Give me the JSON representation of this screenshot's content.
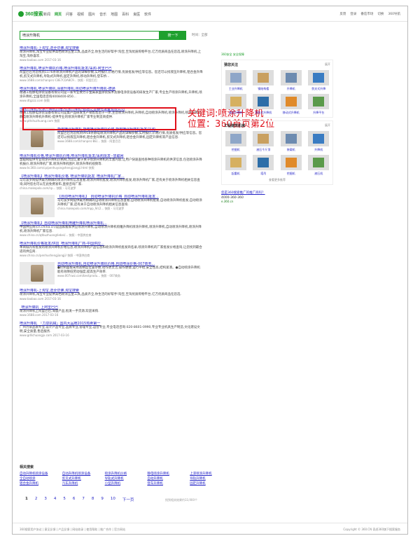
{
  "header": {
    "logo": "360搜索",
    "nav": [
      "新闻",
      "网页",
      "问答",
      "视频",
      "图片",
      "音乐",
      "地图",
      "百科",
      "良医",
      "软件"
    ],
    "nav_active_index": 1,
    "user_links": [
      "反馈",
      "登录",
      "番茄市场",
      "切换",
      "360导航"
    ]
  },
  "search": {
    "query": "喷涂升降机",
    "button": "搜一下",
    "time_filter": "时间：全部"
  },
  "annotation": {
    "line1": "关键词:喷涂升降机",
    "line2": "位置：360首页第2位"
  },
  "results": [
    {
      "title": "喷涂升降机-上淘宝,选全仿佛,淘宝搜索",
      "desc": "喷涂升降机,淘宝专业提供高档喷涂五金工具,品类齐全,你生活的好帮手!淘宝,至淘优质购物平台,亿万优质商品任您选,喷涂升降机,上淘宝,淘你喜欢.",
      "url": "www.taobao.com",
      "meta": "2017-03-16",
      "ad": true
    },
    {
      "title": "喷涂升降机,喷涂升降机价格,喷涂升降机批发/采购-阿里巴巴",
      "desc": "阿里巴巴为您找到1176条喷涂升降机产品的详细参数,实时报价,价格行情,优质批发/供应等信息。您还可以找液压升降机,铝合金升降机,剪叉式升降机,导轨式升降机,固定升降机,移动升降机,登车桥...",
      "url": "www.1688.com/chanpin/-C8E7CDABC9...",
      "meta": "快照 - 阿里巴巴"
    },
    {
      "title": "喷涂升降机,喷涂升降机,涂装升降机,自动喷涂升降升降机-德通",
      "desc": "德通工程静电涂装设备有限公司是一家专业致力于金属表面涂装技术及静电涂装设备的研发生产厂家,专业生产喷涂升降机,升降机,喷涂升降机,全国电话咨询4008400-850...",
      "url": "www.dtgzzz.com",
      "meta": "快照"
    },
    {
      "title": "喷涂升降机,喷涂升降机价格,喷涂升降机-德通泛普静电设备有限公司",
      "desc": "德通工程静电涂装设备有限公司是集产品研发生产销售售后于一体,主营喷涂升降机,升降机,自动喷涂升降机,喷涂升降机,喷涂升降机,静电喷涂升降机升降机-提供专业的喷涂升降机厂家专业制造商提供.",
      "url": "www.pttshuzhuang.com",
      "meta": "快照"
    },
    {
      "title": "静电喷涂升降机,静电喷涂升降机价格,静电喷涂升降机批发/采购...",
      "desc": "阿里巴巴为您找到9958条静电喷涂升降机产品的详细参数,实时报价,价格行情,优质批发/供应等信息。您还可以找液压升降机,铝合金升降机,剪叉式升降机,铝合金升降机,固定升降机等产品信息.",
      "url": "www.1688.com/chanpin/-BE/...",
      "meta": "快照 - 阿里巴巴",
      "img": true
    },
    {
      "title": "喷涂升降机价格,喷涂升降机价格,喷涂升降机批发/采购批发--慧聪网",
      "desc": "慧聪网提供专业喷涂升降机价格网,为您汇聚于关于喷涂升降机的丰富内容,让用户快速查找各种喷涂升降机的供求信息,包括喷涂升降机报价,喷涂升降机厂家,喷涂升降机图片,喷涂升降机视频等.",
      "url": "www.hc360.com/cp/penhuyongshengjiangji.html",
      "meta": "快照"
    },
    {
      "title": "【喷涂升降机】喷涂升降机价格_喷涂升降机批发_喷涂升降机厂家...",
      "desc": "马可波罗网提供最为精确的喷涂升降机信息查看,喷涂升降机批发,喷涂升降机批发,喷涂升降机厂家,还有关于喷涂升降机相关信息查询,同时您也可以在此免费发布,直接咨询厂家.",
      "url": "china.makepolo.com/cp...",
      "meta": "快照 - 马可波罗"
    },
    {
      "title": "【自动喷涂升降机】_自动喷涂升降机价格_自动喷涂升降机批发...",
      "desc": "马可波罗网提供最为精确的自动喷涂升降机信息查看,自动喷涂升降机批发,自动喷涂升降机批发,自动喷涂升降机厂家,还有关于自动喷涂升降机相关信息查询.",
      "url": "china.makepolo.com/mpp_9/c2...",
      "meta": "快照 - 马可波罗",
      "img": true
    },
    {
      "title": "【喷涂升降机】自动喷涂升降机喷雕升降机喷涂升降机...",
      "desc": "中国供应商(cn.china.cn)是国家搬家供应喷涂升降机,自动喷涂升降机喷雕升降机喷涂升降机,喷涂升降机,自动喷涂升降机,喷涂升降机,喷涂升降机厂家信息.",
      "url": "www.china.cn/qtbuzhuangtiebei/...",
      "meta": "快照 - 中国供应商"
    },
    {
      "title": "喷涂升降机价格批发/供应_喷涂升降机厂商-中国供应...",
      "desc": "本商城内有批发的喷涂升降机价格信息,喷涂升降机产品信息和喷涂升降机批发商名录,喷涂升降机的厂家批发价格查询,让您找到最合适的供应商.",
      "url": "www.china.cn/penhushengjiangji/",
      "meta": "快照 - 中国供应商"
    },
    {
      "title": "自动喷涂升降机,自动喷涂升降机价格,自动喷涂价格-007商务...",
      "desc": "●控制面板采用高精度位置参数,动作更灵活,操作便捷,运行平稳,安全性高,结构紧凑。●自动喷涂升降机能有效降低劳动强度,提高生产效率.",
      "url": "www.007swz.com/bestprodu...",
      "meta": "快照 - 007商务",
      "img": true
    },
    {
      "title": "喷涂升降机-上淘宝,选全仿佛,淘宝搜索",
      "desc": "喷涂升降机,淘宝专业提供高档喷涂五金工具,品类齐全,你生活的好帮手!淘宝,至淘优质购物平台,亿万优质商品任您选.",
      "url": "www.taobao.com",
      "meta": "2017-03-16",
      "ad": true
    },
    {
      "title": "_喷涂升降机_上阿里巴巴",
      "desc": "喷涂升降机上阿里巴巴,海量产品,批发一手货源,欢迎采购.",
      "url": "www.1688.com",
      "meta": "2017-03-16"
    },
    {
      "title": "喷涂升降机_「力泉机械」国内大品牌2015热卖第一",
      "desc": "广州力泉品质专业,设计产品专业,品质专业,管理专业,运营专业,专业电话咨询:020-8601-0990,专业专业机具生产制造,文化建设文明,安全质量,售后服务.",
      "url": "www.gdlichuangjx.com",
      "meta": "2017-03-16"
    }
  ],
  "side": {
    "safe": "360安全 安全保障",
    "block1": {
      "title": "猜您关注",
      "more": "展开",
      "items": [
        "工业升降机",
        "钢结构楼",
        "升降机",
        "剪叉式升降",
        "液压升降机",
        "导轨式升降机",
        "移动式升降机",
        "升降平台"
      ]
    },
    "block2": {
      "title": "工程建筑机械",
      "more": "展开",
      "items": [
        "挖掘机",
        "液压千斤顶",
        "装载机",
        "升降机",
        "起重机",
        "塔吊",
        "挖掘机",
        "液压机"
      ]
    },
    "more_link": "查看更多推荐",
    "feedback": "您是360搜索推广的推广商吗？",
    "phone": "4000-360-360",
    "addr": "e.360.cn"
  },
  "related": {
    "title": "相关搜索",
    "items": [
      "自动升降机喷涂设备",
      "自动升降机喷涂设备",
      "喷涂升降机价格",
      "静电喷涂升降机",
      "上漆喷涂升降机",
      "全自动喷涂",
      "剪叉式升降机",
      "导轨式升降机",
      "自动升降机",
      "导轨升降机",
      "铝合金升降机",
      "汽车升降机",
      "小型升降机",
      "登车升降机",
      "固定升降机"
    ]
  },
  "pager": {
    "pages": [
      "1",
      "2",
      "3",
      "4",
      "5",
      "6",
      "7",
      "8",
      "9",
      "10"
    ],
    "next": "下一页",
    "count": "找到相关结果约33,900个"
  },
  "footer": {
    "left": "360搜索用户协议 | 意见反馈 | 产品反馈 | 网站收录 | 使用帮助 | 推广合作 | 官方网站",
    "right": "Copyright © 360.CN 奇虎360旗下搜索服务"
  }
}
